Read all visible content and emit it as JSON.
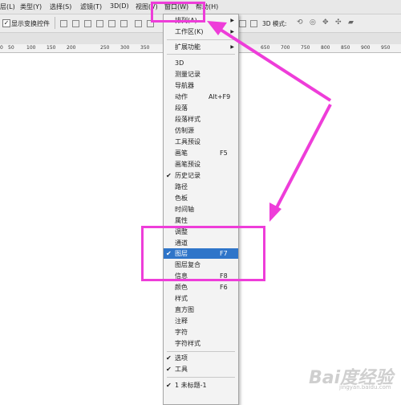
{
  "menubar": {
    "items": [
      {
        "label": "层(L)"
      },
      {
        "label": "类型(Y)"
      },
      {
        "label": "选择(S)"
      },
      {
        "label": "滤镜(T)"
      },
      {
        "label": "3D(D)"
      },
      {
        "label": "视图(V)"
      },
      {
        "label": "窗口(W)"
      },
      {
        "label": "帮助(H)"
      }
    ]
  },
  "options_bar": {
    "show_transform_label": "显示变换控件",
    "show_transform_checked": true,
    "mode_3d_label": "3D 模式:"
  },
  "ruler": {
    "ticks": [
      "0",
      "50",
      "100",
      "150",
      "200",
      "250",
      "300",
      "350",
      "650",
      "700",
      "750",
      "800",
      "850",
      "900",
      "950"
    ]
  },
  "window_menu": {
    "items": [
      {
        "label": "排列(A)",
        "submenu": true
      },
      {
        "label": "工作区(K)",
        "submenu": true
      },
      {
        "label": "扩展功能",
        "submenu": true
      },
      {
        "label": "3D"
      },
      {
        "label": "测量记录"
      },
      {
        "label": "导航器"
      },
      {
        "label": "动作",
        "shortcut": "Alt+F9"
      },
      {
        "label": "段落"
      },
      {
        "label": "段落样式"
      },
      {
        "label": "仿制源"
      },
      {
        "label": "工具预设"
      },
      {
        "label": "画笔",
        "shortcut": "F5"
      },
      {
        "label": "画笔预设"
      },
      {
        "label": "历史记录",
        "checked": true
      },
      {
        "label": "路径"
      },
      {
        "label": "色板"
      },
      {
        "label": "时间轴"
      },
      {
        "label": "属性"
      },
      {
        "label": "调整"
      },
      {
        "label": "通道"
      },
      {
        "label": "图层",
        "shortcut": "F7",
        "checked": true,
        "selected": true
      },
      {
        "label": "图层复合"
      },
      {
        "label": "信息",
        "shortcut": "F8"
      },
      {
        "label": "颜色",
        "shortcut": "F6"
      },
      {
        "label": "样式"
      },
      {
        "label": "直方图"
      },
      {
        "label": "注释"
      },
      {
        "label": "字符"
      },
      {
        "label": "字符样式"
      },
      {
        "label": "选项",
        "checked": true
      },
      {
        "label": "工具",
        "checked": true
      },
      {
        "label": "1 未标题-1",
        "checked": true
      }
    ]
  },
  "watermark": {
    "text": "Bai度经验",
    "sub": "jingyan.baidu.com"
  },
  "colors": {
    "highlight": "#ee3dd9",
    "selection": "#2f75c9"
  }
}
